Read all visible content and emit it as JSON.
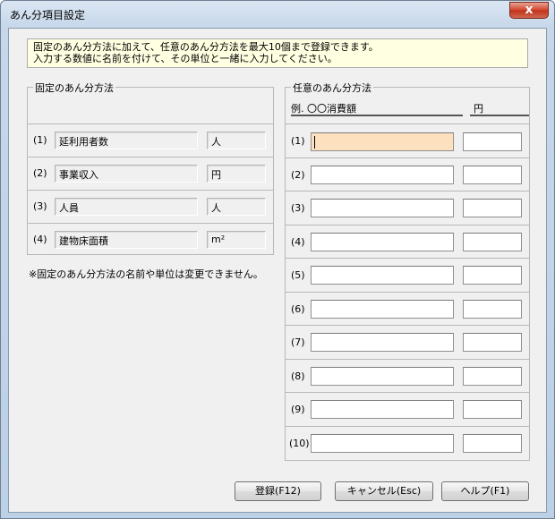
{
  "window": {
    "title": "あん分項目設定",
    "close_symbol": "x"
  },
  "info": {
    "line1": "固定のあん分方法に加えて、任意のあん分方法を最大10個まで登録できます。",
    "line2": "入力する数値に名前を付けて、その単位と一緒に入力してください。"
  },
  "fixed": {
    "title": "固定のあん分方法",
    "rows": [
      {
        "num": "(1)",
        "name": "延利用者数",
        "unit": "人"
      },
      {
        "num": "(2)",
        "name": "事業収入",
        "unit": "円"
      },
      {
        "num": "(3)",
        "name": "人員",
        "unit": "人"
      },
      {
        "num": "(4)",
        "name": "建物床面積",
        "unit": "m²"
      }
    ],
    "note": "※固定のあん分方法の名前や単位は変更できません。"
  },
  "custom": {
    "title": "任意のあん分方法",
    "example_name": "例. 〇〇消費額",
    "example_unit": "円",
    "rows": [
      {
        "num": "(1)",
        "name": "",
        "unit": ""
      },
      {
        "num": "(2)",
        "name": "",
        "unit": ""
      },
      {
        "num": "(3)",
        "name": "",
        "unit": ""
      },
      {
        "num": "(4)",
        "name": "",
        "unit": ""
      },
      {
        "num": "(5)",
        "name": "",
        "unit": ""
      },
      {
        "num": "(6)",
        "name": "",
        "unit": ""
      },
      {
        "num": "(7)",
        "name": "",
        "unit": ""
      },
      {
        "num": "(8)",
        "name": "",
        "unit": ""
      },
      {
        "num": "(9)",
        "name": "",
        "unit": ""
      },
      {
        "num": "(10)",
        "name": "",
        "unit": ""
      }
    ]
  },
  "buttons": {
    "register": "登録(F12)",
    "cancel": "キャンセル(Esc)",
    "help": "ヘルプ(F1)"
  }
}
